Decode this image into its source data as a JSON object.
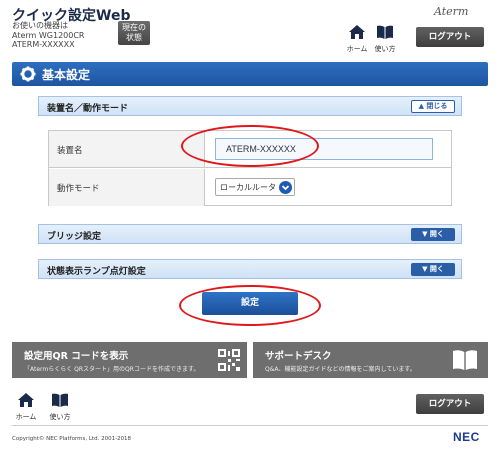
{
  "header": {
    "app_title": "クイック設定Web",
    "device_label": "お使いの機器は",
    "device_model": "Aterm WG1200CR",
    "device_name": "ATERM-XXXXXX",
    "status_button": [
      "現在の",
      "状態"
    ],
    "brand": "Aterm",
    "home_label": "ホーム",
    "howto_label": "使い方",
    "logout_label": "ログアウト"
  },
  "page": {
    "title": "基本設定"
  },
  "sections": {
    "device_mode": {
      "title": "装置名／動作モード",
      "toggle_label": "閉じる",
      "state": "open"
    },
    "bridge": {
      "title": "ブリッジ設定",
      "toggle_label": "開く",
      "state": "closed"
    },
    "lamp": {
      "title": "状態表示ランプ点灯設定",
      "toggle_label": "開く",
      "state": "closed"
    }
  },
  "form": {
    "device_name_label": "装置名",
    "device_name_value": "ATERM-XXXXXX",
    "mode_label": "動作モード",
    "mode_value": "ローカルルータ"
  },
  "save_label": "設定",
  "banners": {
    "qr": {
      "title": "設定用QR コードを表示",
      "desc": "「Atermらくらく QRスタート」用のQRコードを作成できます。"
    },
    "support": {
      "title": "サポートデスク",
      "desc": "Q&A、機能設定ガイドなどの情報をご案内しています。"
    }
  },
  "footer": {
    "home_label": "ホーム",
    "howto_label": "使い方",
    "logout_label": "ログアウト",
    "copyright": "Copyright© NEC Platforms, Ltd. 2001-2018",
    "logo": "NEC"
  },
  "colors": {
    "accent_blue": "#1d55a1",
    "highlight_red": "#e0181b",
    "banner_gray": "#6e6e6e"
  }
}
